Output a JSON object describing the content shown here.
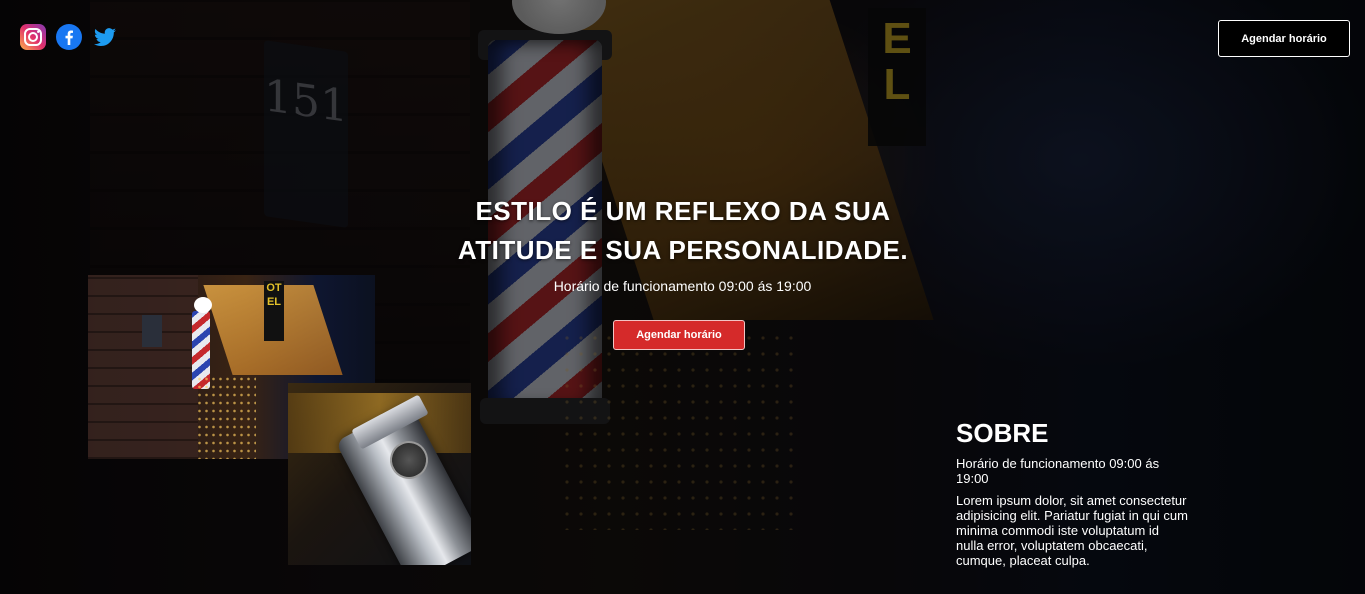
{
  "header": {
    "social": [
      {
        "name": "instagram-icon",
        "color": "#e1306c"
      },
      {
        "name": "facebook-icon",
        "color": "#1877f2"
      },
      {
        "name": "twitter-icon",
        "color": "#1d9bf0"
      }
    ],
    "cta_label": "Agendar horário"
  },
  "hero": {
    "title": "ESTILO É UM REFLEXO DA SUA ATITUDE E SUA PERSONALIDADE.",
    "hours": "Horário de funcionamento 09:00 ás 19:00",
    "cta_label": "Agendar horário"
  },
  "background": {
    "sign_number": "151",
    "hotel_letters": "EL"
  },
  "photos": {
    "photo1_hotel_letters": "OTEL"
  },
  "sobre": {
    "title": "SOBRE",
    "hours": "Horário de funcionamento 09:00 ás 19:00",
    "text": "Lorem ipsum dolor, sit amet consectetur adipisicing elit. Pariatur fugiat in qui cum minima commodi iste voluptatum id nulla error, voluptatem obcaecati, cumque, placeat culpa."
  },
  "colors": {
    "accent_red": "#d52a2a",
    "background": "#0b0b0f",
    "text": "#ffffff"
  }
}
